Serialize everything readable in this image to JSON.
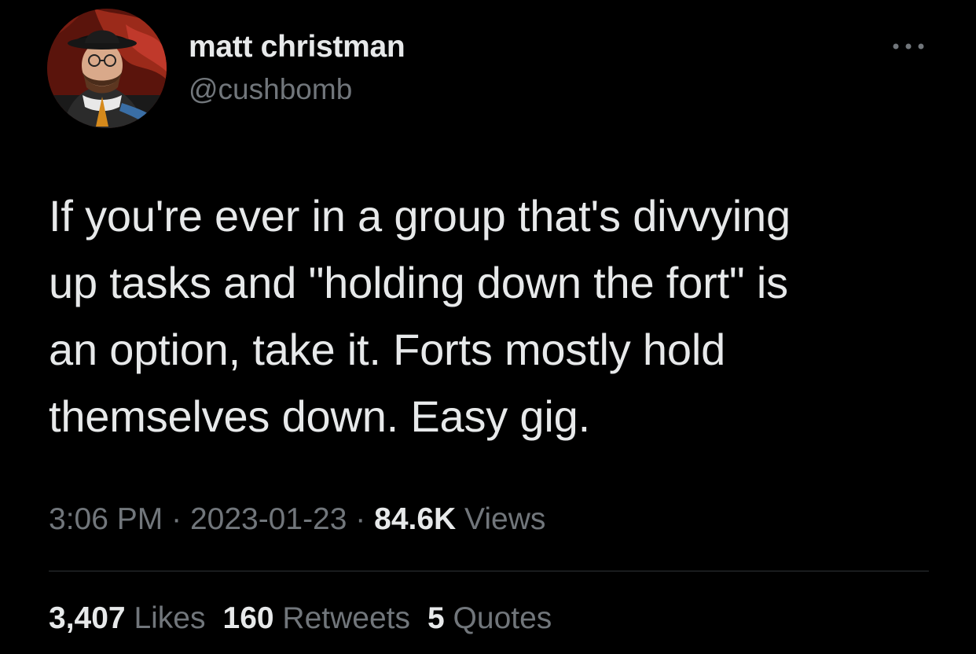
{
  "author": {
    "display_name": "matt christman",
    "handle": "@cushbomb",
    "avatar_icon": "profile-photo"
  },
  "menu_icon": "more-horizontal-icon",
  "tweet": {
    "text": "If you're ever in a group that's divvying\nup tasks and \"holding down the fort\" is\nan option, take it. Forts mostly hold\nthemselves down. Easy gig."
  },
  "meta": {
    "time": "3:06 PM",
    "separator": "·",
    "date": "2023-01-23",
    "views_count": "84.6K",
    "views_label": "Views"
  },
  "stats": {
    "likes_count": "3,407",
    "likes_label": "Likes",
    "retweets_count": "160",
    "retweets_label": "Retweets",
    "quotes_count": "5",
    "quotes_label": "Quotes"
  },
  "colors": {
    "background": "#000000",
    "primary_text": "#e7e9ea",
    "secondary_text": "#71767b",
    "divider": "#2f3336"
  }
}
